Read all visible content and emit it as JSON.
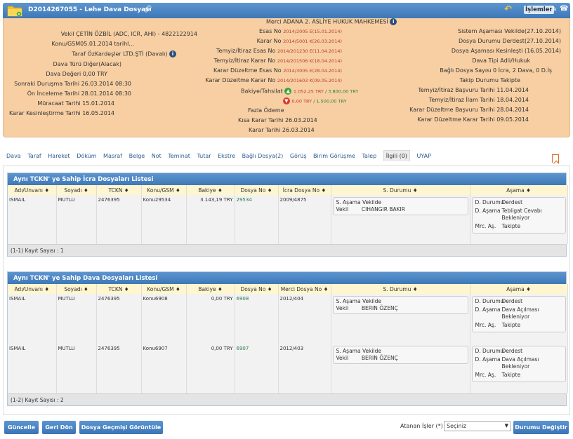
{
  "header": {
    "title": "D2014267055 - Lehe Dava Dosyası",
    "actions_label": "İşlemler"
  },
  "info": {
    "merci_label": "Merci",
    "merci_value": "ADANA 2. ASLİYE HUKUK MAHKEMESİ",
    "left": [
      {
        "label": "Vekil",
        "value": "ÇETİN ÖZBİL (ADC, ICR, AHI) - 4822122914"
      },
      {
        "label": "Konu/GSM",
        "value": "05.01.2014 tarihl..."
      },
      {
        "label": "Taraf",
        "value": "ÖzKardeşler LTD.ŞTİ  (Davalı)"
      },
      {
        "label": "Dava Türü",
        "value": "Diğer(Alacak)"
      },
      {
        "label": "Dava Değeri",
        "value": "0,00 TRY"
      },
      {
        "label": "Sonraki Duruşma Tarihi",
        "value": "26.03.2014 08:30"
      },
      {
        "label": "Ön İnceleme Tarihi",
        "value": "28.01.2014 08:30"
      },
      {
        "label": "Müracaat Tarihi",
        "value": "15.01.2014"
      },
      {
        "label": "Karar Kesinleştirme Tarihi",
        "value": "16.05.2014"
      }
    ],
    "middle": [
      {
        "label": "Esas No",
        "value": "2014/2005 E(15.01.2014)"
      },
      {
        "label": "Karar No",
        "value": "2014/5001 K(26.03.2014)"
      },
      {
        "label": "Temyiz/İtiraz Esas No",
        "value": "2014/201230 E(11.04.2014)"
      },
      {
        "label": "Temyiz/İtiraz Karar No",
        "value": "2014/201506 K(18.04.2014)"
      },
      {
        "label": "Karar Düzeltme Esas No",
        "value": "2014/3005 E(28.04.2014)"
      },
      {
        "label": "Karar Düzeltme Karar No",
        "value": "2014/201603 K(09.05.2014)"
      }
    ],
    "bakiye_label": "Bakiye/Tahsilat",
    "bakiye_up_value": "1.052,25 TRY",
    "bakiye_up_total": "3.800,00 TRY",
    "bakiye_down_value": "0,00 TRY",
    "bakiye_down_total": "1.500,00 TRY",
    "fazla_odeme_label": "Fazla Ödeme",
    "kisa_karar_label": "Kısa Karar Tarihi",
    "kisa_karar_value": "26.03.2014",
    "karar_tarihi_label": "Karar Tarihi",
    "karar_tarihi_value": "26.03.2014",
    "right": [
      {
        "label": "Sistem Aşaması",
        "value": "Vekilde(27.10.2014)"
      },
      {
        "label": "Dosya Durumu",
        "value": "Derdest(27.10.2014)"
      },
      {
        "label": "Dosya Aşaması",
        "value": "Kesinleşti (16.05.2014)"
      },
      {
        "label": "Dava Tipi",
        "value": "Adli/Hukuk"
      },
      {
        "label": "Bağlı Dosya Sayısı",
        "value": "0 İcra, 2 Dava, 0 D.İş"
      },
      {
        "label": "Takip Durumu",
        "value": "Takipte"
      },
      {
        "label": "Temyiz/İtiraz Başvuru Tarihi",
        "value": "11.04.2014"
      },
      {
        "label": "Temyiz/İtiraz İlam Tarihi",
        "value": "18.04.2014"
      },
      {
        "label": "Karar Düzeltme Başvuru Tarihi",
        "value": "28.04.2014"
      },
      {
        "label": "Karar Düzeltme Karar Tarihi",
        "value": "09.05.2014"
      }
    ]
  },
  "tabs": [
    "Dava",
    "Taraf",
    "Hareket",
    "Döküm",
    "Masraf",
    "Belge",
    "Not",
    "Teminat",
    "Tutar",
    "Ekstre",
    "Bağlı Dosya(2)",
    "Görüş",
    "Birim Görüşme",
    "Talep",
    "İlgili (0)",
    "UYAP"
  ],
  "icra_panel": {
    "title": "Aynı TCKN' ye Sahip İcra Dosyaları Listesi",
    "columns": [
      "Adı/Unvanı",
      "Soyadı",
      "TCKN",
      "Konu/GSM",
      "Bakiye",
      "Dosya No",
      "İcra Dosya No",
      "S. Durumu",
      "Aşama"
    ],
    "rows": [
      {
        "ad": "ISMAIL",
        "soyad": "MUTLU",
        "tckn": "2476395",
        "konu": "Konu29534",
        "bakiye": "3.143,19 TRY",
        "dosya": "29534",
        "icra_dosya": "2009/4875",
        "durum": [
          {
            "k": "S. Aşama",
            "v": "Vekilde"
          },
          {
            "k": "Vekil",
            "v": "CIHANGIR BAKIR"
          }
        ],
        "asama": [
          {
            "k": "D. Durumu",
            "v": "Derdest"
          },
          {
            "k": "D. Aşama",
            "v": "Tebligat Cevabı Bekleniyor"
          },
          {
            "k": "Mrc. Aş.",
            "v": "Takipte"
          }
        ]
      }
    ],
    "footer": "(1-1) Kayıt Sayısı : 1"
  },
  "dava_panel": {
    "title": "Aynı TCKN' ye Sahip Dava Dosyaları Listesi",
    "columns": [
      "Adı/Unvanı",
      "Soyadı",
      "TCKN",
      "Konu/GSM",
      "Bakiye",
      "Dosya No",
      "Merci Dosya No",
      "S. Durumu",
      "Aşama"
    ],
    "rows": [
      {
        "ad": "ISMAIL",
        "soyad": "MUTLU",
        "tckn": "2476395",
        "konu": "Konu6908",
        "bakiye": "0,00 TRY",
        "dosya": "6908",
        "merci_dosya": "2012/404",
        "durum": [
          {
            "k": "S. Aşama",
            "v": "Vekilde"
          },
          {
            "k": "Vekil",
            "v": "BERIN ÖZENÇ"
          }
        ],
        "asama": [
          {
            "k": "D. Durumu",
            "v": "Derdest"
          },
          {
            "k": "D. Aşama",
            "v": "Dava Açılması Bekleniyor"
          },
          {
            "k": "Mrc. Aş.",
            "v": "Takipte"
          }
        ]
      },
      {
        "ad": "ISMAIL",
        "soyad": "MUTLU",
        "tckn": "2476395",
        "konu": "Konu6907",
        "bakiye": "0,00 TRY",
        "dosya": "6907",
        "merci_dosya": "2012/403",
        "durum": [
          {
            "k": "S. Aşama",
            "v": "Vekilde"
          },
          {
            "k": "Vekil",
            "v": "BERIN ÖZENÇ"
          }
        ],
        "asama": [
          {
            "k": "D. Durumu",
            "v": "Derdest"
          },
          {
            "k": "D. Aşama",
            "v": "Dava Açılması Bekleniyor"
          },
          {
            "k": "Mrc. Aş.",
            "v": "Takipte"
          }
        ]
      }
    ],
    "footer": "(1-2) Kayıt Sayısı : 2"
  },
  "bottom": {
    "guncelle": "Güncelle",
    "geri_don": "Geri Dön",
    "gecmis": "Dosya Geçmişi Görüntüle",
    "atanan_label": "Atanan İşler (*)",
    "atanan_value": "Seçiniz",
    "durum_degistir": "Durumu Değiştir"
  },
  "colors": {
    "header_blue": "#3d78b7",
    "info_bg": "#f7cfa3",
    "table_header": "#fff6d0",
    "red_value": "#c0392b",
    "green_value": "#2e7d32"
  },
  "icons": [
    "folder-icon",
    "link-icon",
    "undo-icon",
    "edit-icon",
    "phone-icon",
    "info-icon",
    "arrow-up-icon",
    "arrow-down-icon",
    "bookmark-icon",
    "sort-icon",
    "caret-down-icon"
  ]
}
